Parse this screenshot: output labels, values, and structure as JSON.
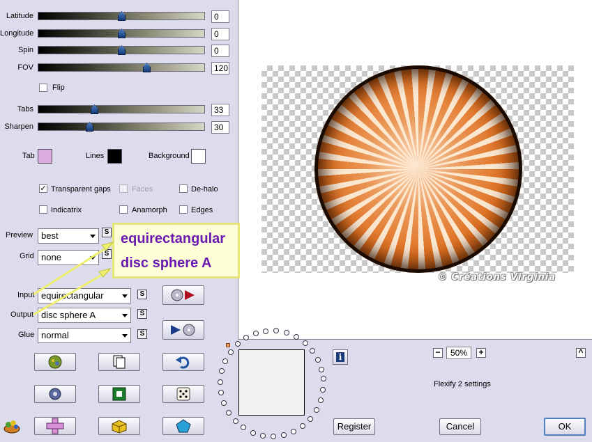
{
  "sliders": [
    {
      "label": "Latitude",
      "value": "0",
      "fraction": 0.5
    },
    {
      "label": "Longitude",
      "value": "0",
      "fraction": 0.5
    },
    {
      "label": "Spin",
      "value": "0",
      "fraction": 0.5
    },
    {
      "label": "FOV",
      "value": "120",
      "fraction": 0.66
    },
    {
      "label": "Tabs",
      "value": "33",
      "fraction": 0.33
    },
    {
      "label": "Sharpen",
      "value": "30",
      "fraction": 0.3
    }
  ],
  "flip": {
    "label": "Flip",
    "checked": false
  },
  "colors": {
    "tab": {
      "label": "Tab",
      "color": "#dcaadc"
    },
    "lines": {
      "label": "Lines",
      "color": "#000000"
    },
    "background": {
      "label": "Background",
      "color": "#ffffff"
    }
  },
  "options": {
    "transparent_gaps": {
      "label": "Transparent gaps",
      "checked": true
    },
    "faces": {
      "label": "Faces",
      "checked": false,
      "disabled": true
    },
    "de_halo": {
      "label": "De-halo",
      "checked": false
    },
    "indicatrix": {
      "label": "Indicatrix",
      "checked": false
    },
    "anamorph": {
      "label": "Anamorph",
      "checked": false
    },
    "edges": {
      "label": "Edges",
      "checked": false
    }
  },
  "selects": {
    "preview": {
      "label": "Preview",
      "value": "best"
    },
    "grid": {
      "label": "Grid",
      "value": "none"
    },
    "input": {
      "label": "Input",
      "value": "equirectangular"
    },
    "output": {
      "label": "Output",
      "value": "disc sphere A"
    },
    "glue": {
      "label": "Glue",
      "value": "normal"
    }
  },
  "callout": {
    "line1": "equirectangular",
    "line2": "disc sphere A"
  },
  "watermark": "© Créations Virginia",
  "zoom": {
    "value": "50%",
    "minus": "−",
    "plus": "+"
  },
  "settings_name": "Flexify 2 settings",
  "buttons": {
    "register": "Register",
    "cancel": "Cancel",
    "ok": "OK"
  },
  "small_button_glyph": "S",
  "icons": {
    "info": "i",
    "collapse": "^"
  }
}
